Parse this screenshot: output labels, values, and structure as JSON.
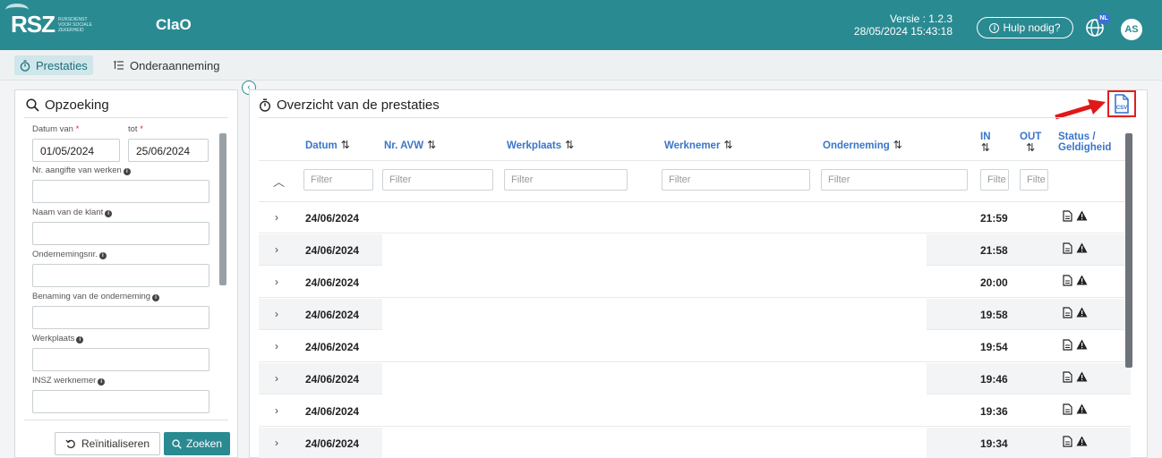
{
  "header": {
    "logo_text": "RSZ",
    "logo_subtext": "RIJKSDIENST VOOR SOCIALE ZEKERHEID",
    "app_name": "ClaO",
    "version_line1": "Versie : 1.2.3",
    "version_line2": "28/05/2024 15:43:18",
    "help_label": "Hulp nodig?",
    "language_badge": "NL",
    "avatar_initials": "AS",
    "accent_color": "#2a8a92"
  },
  "nav": {
    "tabs": [
      {
        "label": "Prestaties",
        "icon": "stopwatch-icon",
        "active": true
      },
      {
        "label": "Onderaanneming",
        "icon": "list-tree-icon",
        "active": false
      }
    ]
  },
  "search_panel": {
    "title": "Opzoeking",
    "date_from_label": "Datum van",
    "date_to_label": "tot",
    "required_mark": "*",
    "date_from_value": "01/05/2024",
    "date_to_value": "25/06/2024",
    "fields": [
      {
        "label": "Nr. aangifte van werken",
        "value": ""
      },
      {
        "label": "Naam van de klant",
        "value": ""
      },
      {
        "label": "Ondernemingsnr.",
        "value": ""
      },
      {
        "label": "Benaming van de onderneming",
        "value": ""
      },
      {
        "label": "Werkplaats",
        "value": ""
      },
      {
        "label": "INSZ werknemer",
        "value": ""
      }
    ],
    "reset_label": "Reïnitialiseren",
    "search_label": "Zoeken"
  },
  "overview": {
    "title": "Overzicht van de prestaties",
    "csv_label": "CSV",
    "columns": {
      "datum": "Datum",
      "nr_avw": "Nr. AVW",
      "werkplaats": "Werkplaats",
      "werknemer": "Werknemer",
      "onderneming": "Onderneming",
      "in": "IN",
      "out": "OUT",
      "status_line1": "Status /",
      "status_line2": "Geldigheid"
    },
    "sort_glyph": "⇅",
    "filter_placeholder": "Filter",
    "filter_short": "Filte",
    "rows": [
      {
        "datum": "24/06/2024",
        "in": "21:59"
      },
      {
        "datum": "24/06/2024",
        "in": "21:58"
      },
      {
        "datum": "24/06/2024",
        "in": "20:00"
      },
      {
        "datum": "24/06/2024",
        "in": "19:58"
      },
      {
        "datum": "24/06/2024",
        "in": "19:54"
      },
      {
        "datum": "24/06/2024",
        "in": "19:46"
      },
      {
        "datum": "24/06/2024",
        "in": "19:36"
      },
      {
        "datum": "24/06/2024",
        "in": "19:34"
      }
    ]
  }
}
